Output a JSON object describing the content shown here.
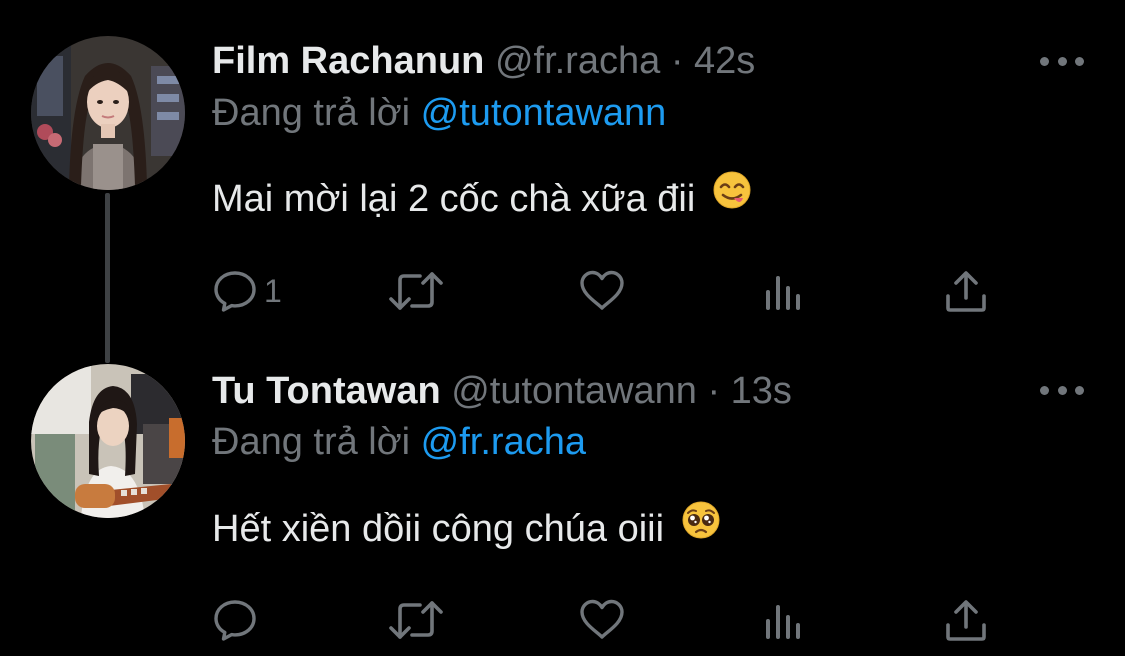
{
  "tweets": [
    {
      "display_name": "Film Rachanun",
      "handle": "@fr.racha",
      "separator": "·",
      "time": "42s",
      "replying_prefix": "Đang trả lời",
      "replying_to": "@tutontawann",
      "text": "Mai mời lại 2 cốc chà xữa đii",
      "emoji": "face-savoring-food",
      "reply_count": "1",
      "avatar": "avatar-film-rachanun"
    },
    {
      "display_name": "Tu Tontawan",
      "handle": "@tutontawann",
      "separator": "·",
      "time": "13s",
      "replying_prefix": "Đang trả lời",
      "replying_to": "@fr.racha",
      "text": "Hết xiền dồii công chúa oiii",
      "emoji": "pleading-face",
      "reply_count": "",
      "avatar": "avatar-tu-tontawan"
    }
  ],
  "icons": {
    "reply": "reply-icon",
    "retweet": "retweet-icon",
    "like": "heart-icon",
    "analytics": "analytics-icon",
    "share": "share-icon",
    "more": "more-dots-icon"
  },
  "colors": {
    "background": "#000000",
    "primary_text": "#e7e9ea",
    "secondary_text": "#71767b",
    "accent": "#1d9bf0",
    "thread_line": "#3e4144"
  }
}
